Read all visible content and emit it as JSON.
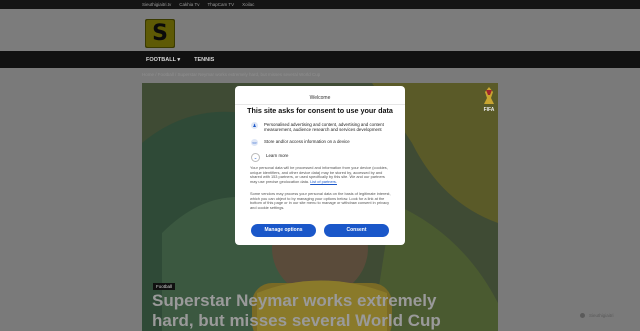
{
  "top_links": [
    "Sieuthigiaitri.tv",
    "Cakhia Tv",
    "ThapCam TV",
    "Xoilac"
  ],
  "logo_letter": "S",
  "nav": [
    "FOOTBALL ▾",
    "TENNIS"
  ],
  "breadcrumb": "Home / Football / Superstar Neymar works extremely hard, but misses several World Cup",
  "hero": {
    "badge": "Football",
    "headline": "Superstar Neymar works extremely hard, but misses several World Cup",
    "fifa": "FIFA"
  },
  "consent": {
    "welcome": "Welcome",
    "title": "This site asks for consent to use your data",
    "purposes": [
      {
        "icon": "person-icon",
        "glyph": "♟",
        "text": "Personalised advertising and content, advertising and content measurement, audience research and services development"
      },
      {
        "icon": "device-icon",
        "glyph": "▭",
        "text": "Store and/or access information on a device"
      },
      {
        "icon": "chevron-down-icon",
        "glyph": "⌄",
        "text": "Learn more"
      }
    ],
    "paragraph1": "Your personal data will be processed and information from your device (cookies, unique identifiers, and other device data) may be stored by, accessed by and shared with 153 partners, or used specifically by this site. We and our partners may use precise geolocation data.",
    "list_link": "List of partners.",
    "paragraph2": "Some vendors may process your personal data on the basis of legitimate interest, which you can object to by managing your options below. Look for a link at the bottom of this page or in our site menu to manage or withdraw consent in privacy and cookie settings.",
    "manage_label": "Manage options",
    "consent_label": "Consent",
    "accent": "#1a57c9"
  },
  "corner_text": "Sieuthigiaitri"
}
